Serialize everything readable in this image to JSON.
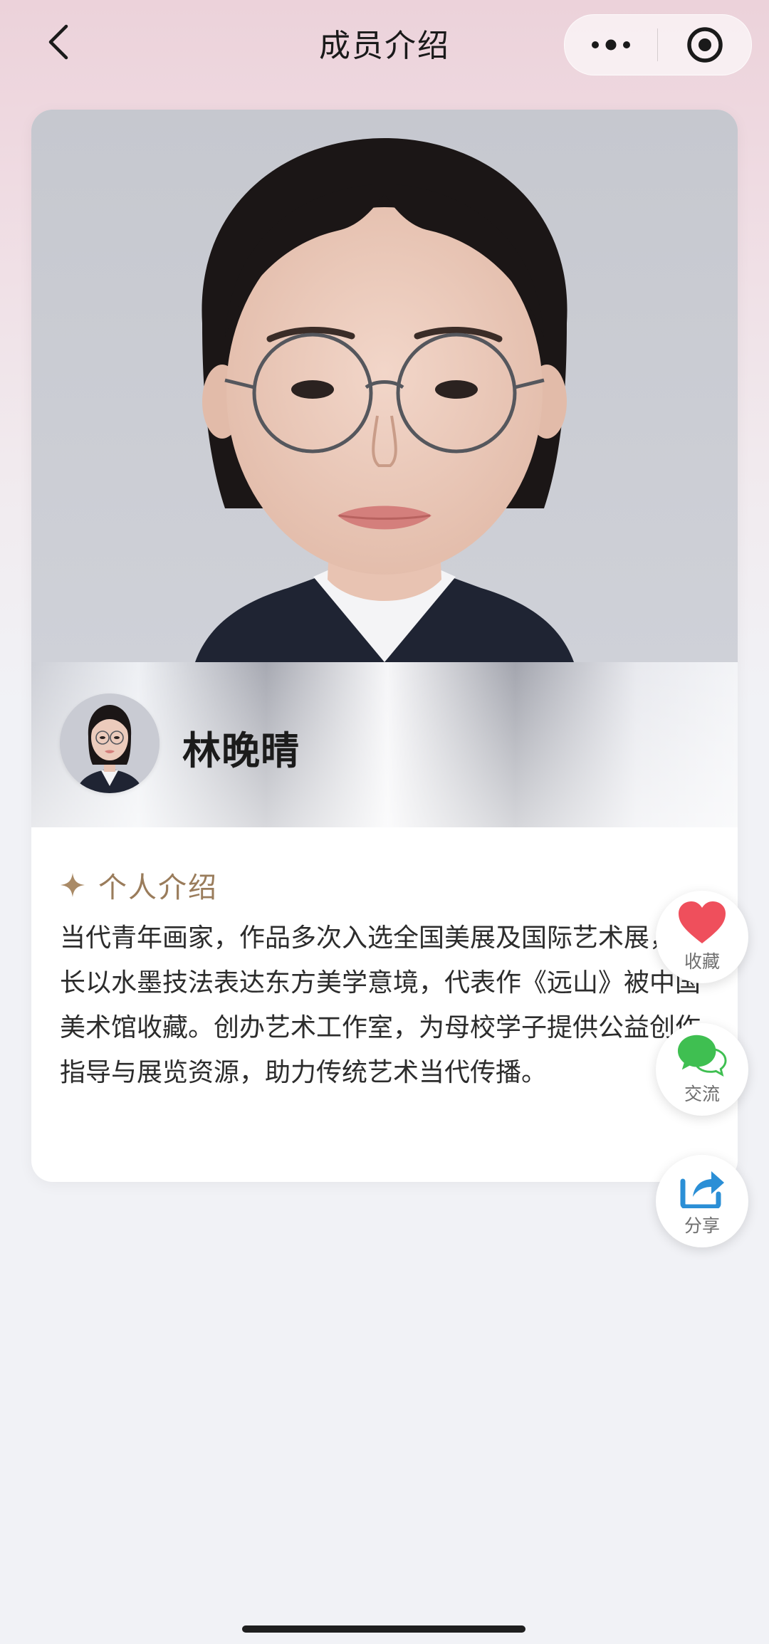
{
  "nav": {
    "title": "成员介绍",
    "icons": {
      "back": "chevron-left-icon",
      "more": "more-dots-icon",
      "close": "target-circle-icon"
    }
  },
  "member": {
    "name": "林晚晴",
    "photo": "portrait-photo",
    "avatar": "avatar-photo"
  },
  "intro": {
    "title": "个人介绍",
    "icon": "sparkle-star-icon",
    "text": "当代青年画家，作品多次入选全国美展及国际艺术展，擅长以水墨技法表达东方美学意境，代表作《远山》被中国美术馆收藏。创办艺术工作室，为母校学子提供公益创作指导与展览资源，助力传统艺术当代传播。"
  },
  "actions": [
    {
      "label": "收藏",
      "icon": "heart-icon"
    },
    {
      "label": "交流",
      "icon": "chat-bubbles-icon"
    },
    {
      "label": "分享",
      "icon": "share-icon"
    }
  ],
  "colors": {
    "accent_gold": "#9a7c5b",
    "heart_red": "#ef4f5c",
    "chat_green": "#3fbf51",
    "share_blue": "#2b8fd6",
    "background_pink": "#ecd2da",
    "background_gray": "#f1f2f6"
  }
}
